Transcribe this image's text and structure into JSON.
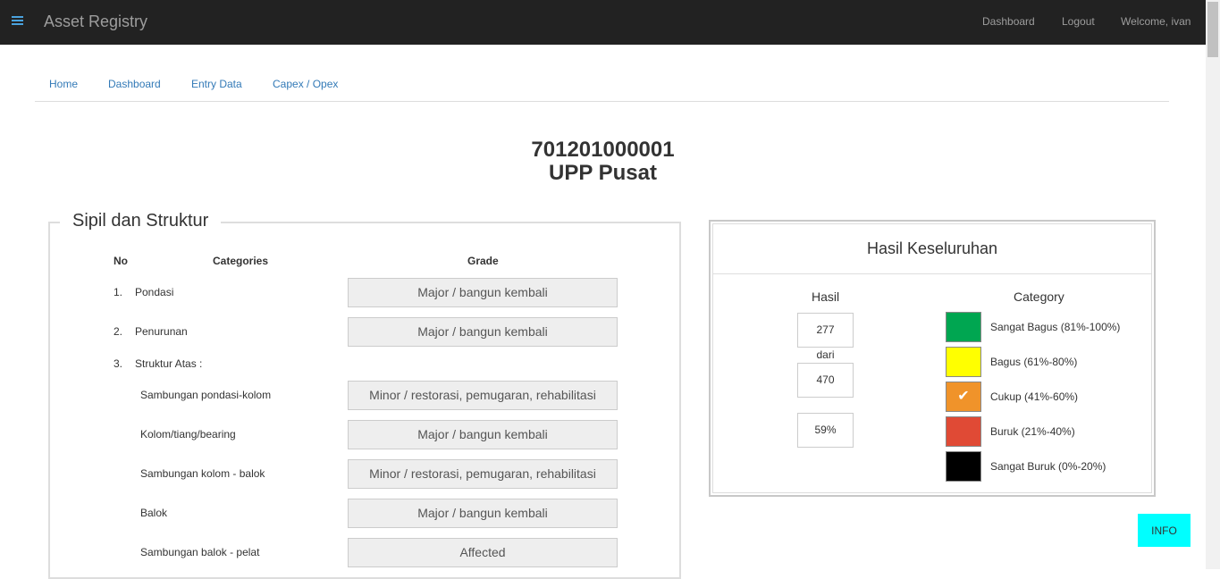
{
  "navbar": {
    "app_title": "Asset Registry",
    "links": [
      {
        "label": "Dashboard",
        "icon": "none"
      },
      {
        "label": "Logout"
      },
      {
        "label": "Welcome, ivan"
      }
    ],
    "menu_icon": "hamburger-icon"
  },
  "subnav": {
    "items": [
      "Home",
      "Dashboard",
      "Entry Data",
      "Capex / Opex"
    ]
  },
  "header": {
    "code": "701201000001",
    "unit": "UPP Pusat"
  },
  "section": {
    "title": "Sipil dan Struktur",
    "columns": {
      "no": "No",
      "categories": "Categories",
      "grade": "Grade"
    },
    "rows": [
      {
        "no": "1.",
        "label": "Pondasi",
        "grade": "Major / bangun kembali"
      },
      {
        "no": "2.",
        "label": "Penurunan",
        "grade": "Major / bangun kembali"
      },
      {
        "no": "3.",
        "label": "Struktur Atas :",
        "grade": ""
      },
      {
        "no": "",
        "label": "Sambungan pondasi-kolom",
        "grade": "Minor / restorasi, pemugaran, rehabilitasi"
      },
      {
        "no": "",
        "label": "Kolom/tiang/bearing",
        "grade": "Major / bangun kembali"
      },
      {
        "no": "",
        "label": "Sambungan kolom - balok",
        "grade": "Minor / restorasi, pemugaran, rehabilitasi"
      },
      {
        "no": "",
        "label": "Balok",
        "grade": "Major / bangun kembali"
      },
      {
        "no": "",
        "label": "Sambungan balok - pelat",
        "grade": "Affected"
      }
    ]
  },
  "result": {
    "title": "Hasil Keseluruhan",
    "hasil_label": "Hasil",
    "category_label": "Category",
    "score": "277",
    "dari": "dari",
    "total": "470",
    "percent": "59%",
    "categories": [
      {
        "label": "Sangat Bagus  (81%-100%)",
        "color": "#00a651",
        "selected": false
      },
      {
        "label": "Bagus  (61%-80%)",
        "color": "#ffff00",
        "selected": false
      },
      {
        "label": "Cukup  (41%-60%)",
        "color": "#f0932a",
        "selected": true
      },
      {
        "label": "Buruk  (21%-40%)",
        "color": "#e04a35",
        "selected": false
      },
      {
        "label": "Sangat Buruk  (0%-20%)",
        "color": "#000000",
        "selected": false
      }
    ]
  },
  "info_button": "INFO"
}
